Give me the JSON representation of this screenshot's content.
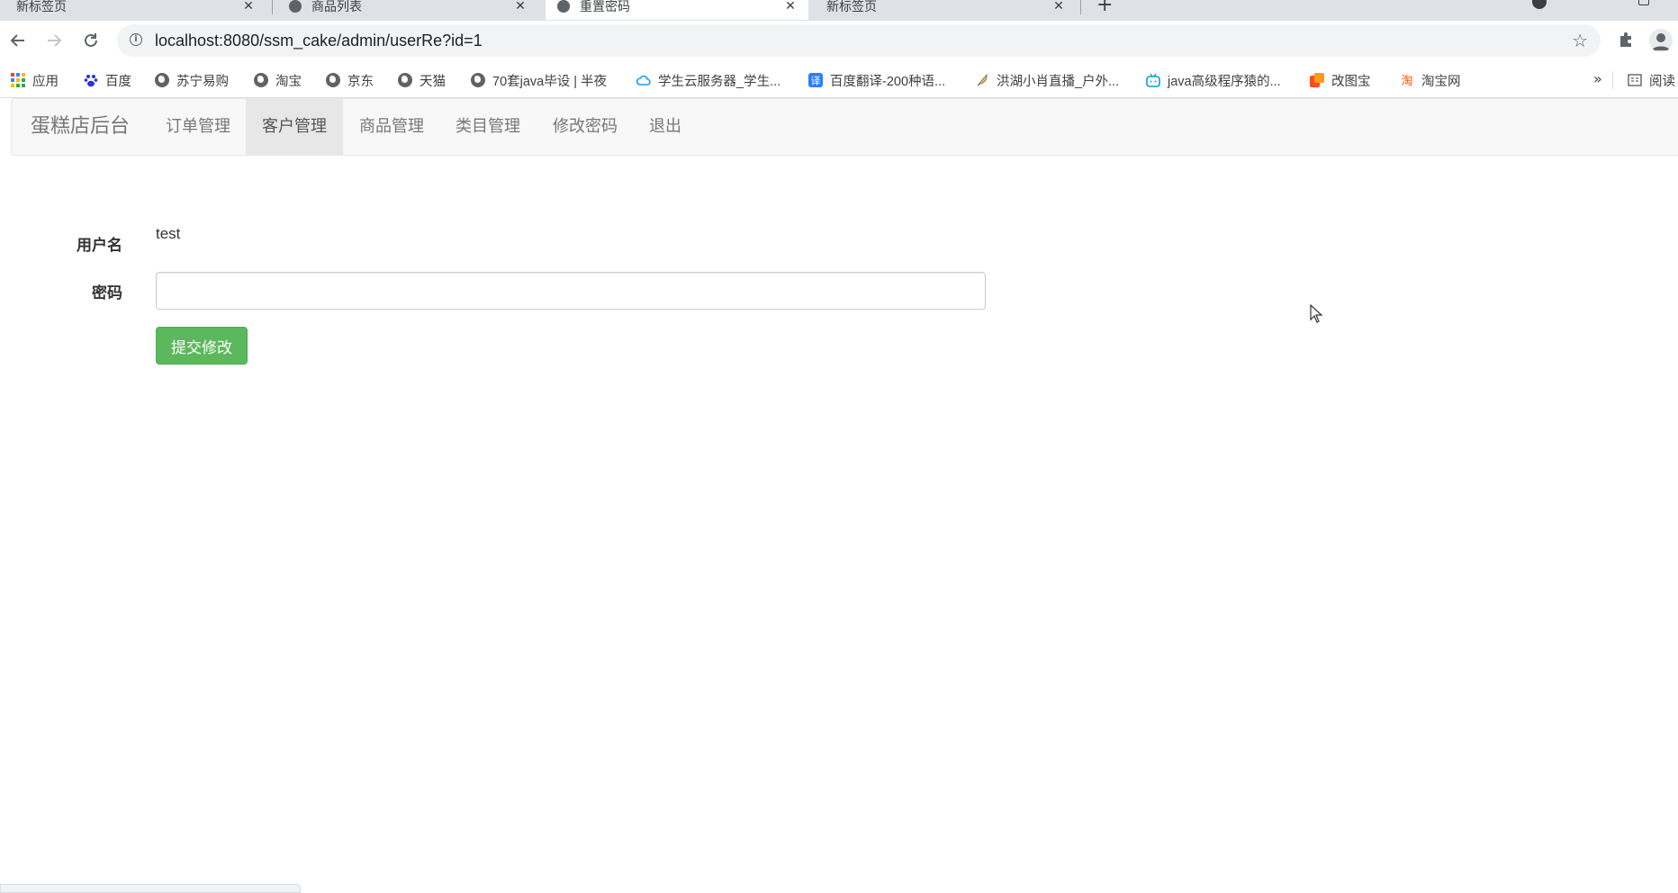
{
  "browser": {
    "tabs": [
      {
        "title": "新标签页",
        "active": false
      },
      {
        "title": "商品列表",
        "active": false
      },
      {
        "title": "重置密码",
        "active": true
      },
      {
        "title": "新标签页",
        "active": false
      }
    ],
    "url": "localhost:8080/ssm_cake/admin/userRe?id=1",
    "bookmarks": [
      {
        "label": "应用",
        "icon": "apps-grid-icon"
      },
      {
        "label": "百度",
        "icon": "baidu-paw-icon"
      },
      {
        "label": "苏宁易购",
        "icon": "globe-icon"
      },
      {
        "label": "淘宝",
        "icon": "globe-icon"
      },
      {
        "label": "京东",
        "icon": "globe-icon"
      },
      {
        "label": "天猫",
        "icon": "globe-icon"
      },
      {
        "label": "70套java毕设 | 半夜",
        "icon": "globe-icon"
      },
      {
        "label": "学生云服务器_学生...",
        "icon": "cloud-icon"
      },
      {
        "label": "百度翻译-200种语...",
        "icon": "translate-icon"
      },
      {
        "label": "洪湖小肖直播_户外...",
        "icon": "feather-icon"
      },
      {
        "label": "java高级程序猿的...",
        "icon": "bilibili-icon"
      },
      {
        "label": "改图宝",
        "icon": "image-tool-icon"
      },
      {
        "label": "淘宝网",
        "icon": "taobao-icon"
      }
    ],
    "bookmarks_overflow": "»",
    "reading_list": "阅读"
  },
  "navbar": {
    "brand": "蛋糕店后台",
    "items": [
      {
        "label": "订单管理",
        "active": false
      },
      {
        "label": "客户管理",
        "active": true
      },
      {
        "label": "商品管理",
        "active": false
      },
      {
        "label": "类目管理",
        "active": false
      },
      {
        "label": "修改密码",
        "active": false
      },
      {
        "label": "退出",
        "active": false
      }
    ]
  },
  "form": {
    "username_label": "用户名",
    "username_value": "test",
    "password_label": "密码",
    "password_value": "",
    "submit_label": "提交修改"
  },
  "colors": {
    "success_button": "#5cb85c",
    "navbar_bg": "#f8f8f8",
    "navbar_active_bg": "#e7e7e7"
  }
}
